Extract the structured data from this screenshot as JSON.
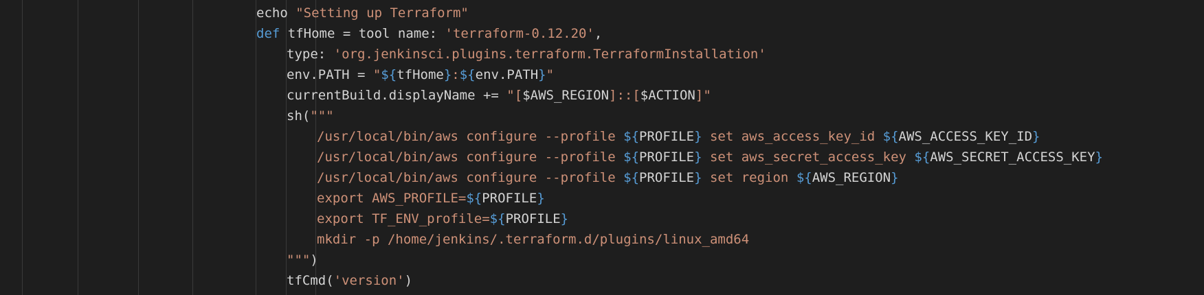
{
  "editor": {
    "colors": {
      "background": "#1e1e1e",
      "plain": "#d4d4d4",
      "string": "#ce9178",
      "keyword": "#569cd6",
      "variable": "#9cdcfe",
      "indent_guide": "#3a3a3a"
    },
    "lines": [
      {
        "indent": 4,
        "tokens": [
          {
            "t": "echo ",
            "c": "plain"
          },
          {
            "t": "\"Setting up Terraform\"",
            "c": "string"
          }
        ]
      },
      {
        "indent": 4,
        "tokens": [
          {
            "t": "def",
            "c": "keyword"
          },
          {
            "t": " tfHome = tool name: ",
            "c": "plain"
          },
          {
            "t": "'terraform-0.12.20'",
            "c": "string"
          },
          {
            "t": ",",
            "c": "plain"
          }
        ]
      },
      {
        "indent": 5,
        "tokens": [
          {
            "t": "type: ",
            "c": "plain"
          },
          {
            "t": "'org.jenkinsci.plugins.terraform.TerraformInstallation'",
            "c": "string"
          }
        ]
      },
      {
        "indent": 5,
        "tokens": [
          {
            "t": "env.PATH = ",
            "c": "plain"
          },
          {
            "t": "\"",
            "c": "string"
          },
          {
            "t": "${",
            "c": "interp"
          },
          {
            "t": "tfHome",
            "c": "plain"
          },
          {
            "t": "}",
            "c": "interp"
          },
          {
            "t": ":",
            "c": "string"
          },
          {
            "t": "${",
            "c": "interp"
          },
          {
            "t": "env.PATH",
            "c": "plain"
          },
          {
            "t": "}",
            "c": "interp"
          },
          {
            "t": "\"",
            "c": "string"
          }
        ]
      },
      {
        "indent": 5,
        "tokens": [
          {
            "t": "currentBuild.displayName += ",
            "c": "plain"
          },
          {
            "t": "\"[",
            "c": "string"
          },
          {
            "t": "$AWS_REGION",
            "c": "variable"
          },
          {
            "t": "]::[",
            "c": "string"
          },
          {
            "t": "$ACTION",
            "c": "variable"
          },
          {
            "t": "]\"",
            "c": "string"
          }
        ]
      },
      {
        "indent": 5,
        "tokens": [
          {
            "t": "sh(",
            "c": "plain"
          },
          {
            "t": "\"\"\"",
            "c": "string"
          }
        ]
      },
      {
        "indent": 6,
        "tokens": [
          {
            "t": "/usr/local/bin/aws configure --profile ",
            "c": "string"
          },
          {
            "t": "${",
            "c": "interp"
          },
          {
            "t": "PROFILE",
            "c": "plain"
          },
          {
            "t": "}",
            "c": "interp"
          },
          {
            "t": " set aws_access_key_id ",
            "c": "string"
          },
          {
            "t": "${",
            "c": "interp"
          },
          {
            "t": "AWS_ACCESS_KEY_ID",
            "c": "plain"
          },
          {
            "t": "}",
            "c": "interp"
          }
        ]
      },
      {
        "indent": 6,
        "tokens": [
          {
            "t": "/usr/local/bin/aws configure --profile ",
            "c": "string"
          },
          {
            "t": "${",
            "c": "interp"
          },
          {
            "t": "PROFILE",
            "c": "plain"
          },
          {
            "t": "}",
            "c": "interp"
          },
          {
            "t": " set aws_secret_access_key ",
            "c": "string"
          },
          {
            "t": "${",
            "c": "interp"
          },
          {
            "t": "AWS_SECRET_ACCESS_KEY",
            "c": "plain"
          },
          {
            "t": "}",
            "c": "interp"
          }
        ]
      },
      {
        "indent": 6,
        "tokens": [
          {
            "t": "/usr/local/bin/aws configure --profile ",
            "c": "string"
          },
          {
            "t": "${",
            "c": "interp"
          },
          {
            "t": "PROFILE",
            "c": "plain"
          },
          {
            "t": "}",
            "c": "interp"
          },
          {
            "t": " set region ",
            "c": "string"
          },
          {
            "t": "${",
            "c": "interp"
          },
          {
            "t": "AWS_REGION",
            "c": "plain"
          },
          {
            "t": "}",
            "c": "interp"
          }
        ]
      },
      {
        "indent": 6,
        "tokens": [
          {
            "t": "export AWS_PROFILE=",
            "c": "string"
          },
          {
            "t": "${",
            "c": "interp"
          },
          {
            "t": "PROFILE",
            "c": "plain"
          },
          {
            "t": "}",
            "c": "interp"
          }
        ]
      },
      {
        "indent": 6,
        "tokens": [
          {
            "t": "export TF_ENV_profile=",
            "c": "string"
          },
          {
            "t": "${",
            "c": "interp"
          },
          {
            "t": "PROFILE",
            "c": "plain"
          },
          {
            "t": "}",
            "c": "interp"
          }
        ]
      },
      {
        "indent": 6,
        "tokens": [
          {
            "t": "mkdir -p /home/jenkins/.terraform.d/plugins/linux_amd64",
            "c": "string"
          }
        ]
      },
      {
        "indent": 5,
        "tokens": [
          {
            "t": "\"\"\"",
            "c": "string"
          },
          {
            "t": ")",
            "c": "plain"
          }
        ]
      },
      {
        "indent": 5,
        "tokens": [
          {
            "t": "tfCmd(",
            "c": "plain"
          },
          {
            "t": "'version'",
            "c": "string"
          },
          {
            "t": ")",
            "c": "plain"
          }
        ]
      }
    ]
  }
}
